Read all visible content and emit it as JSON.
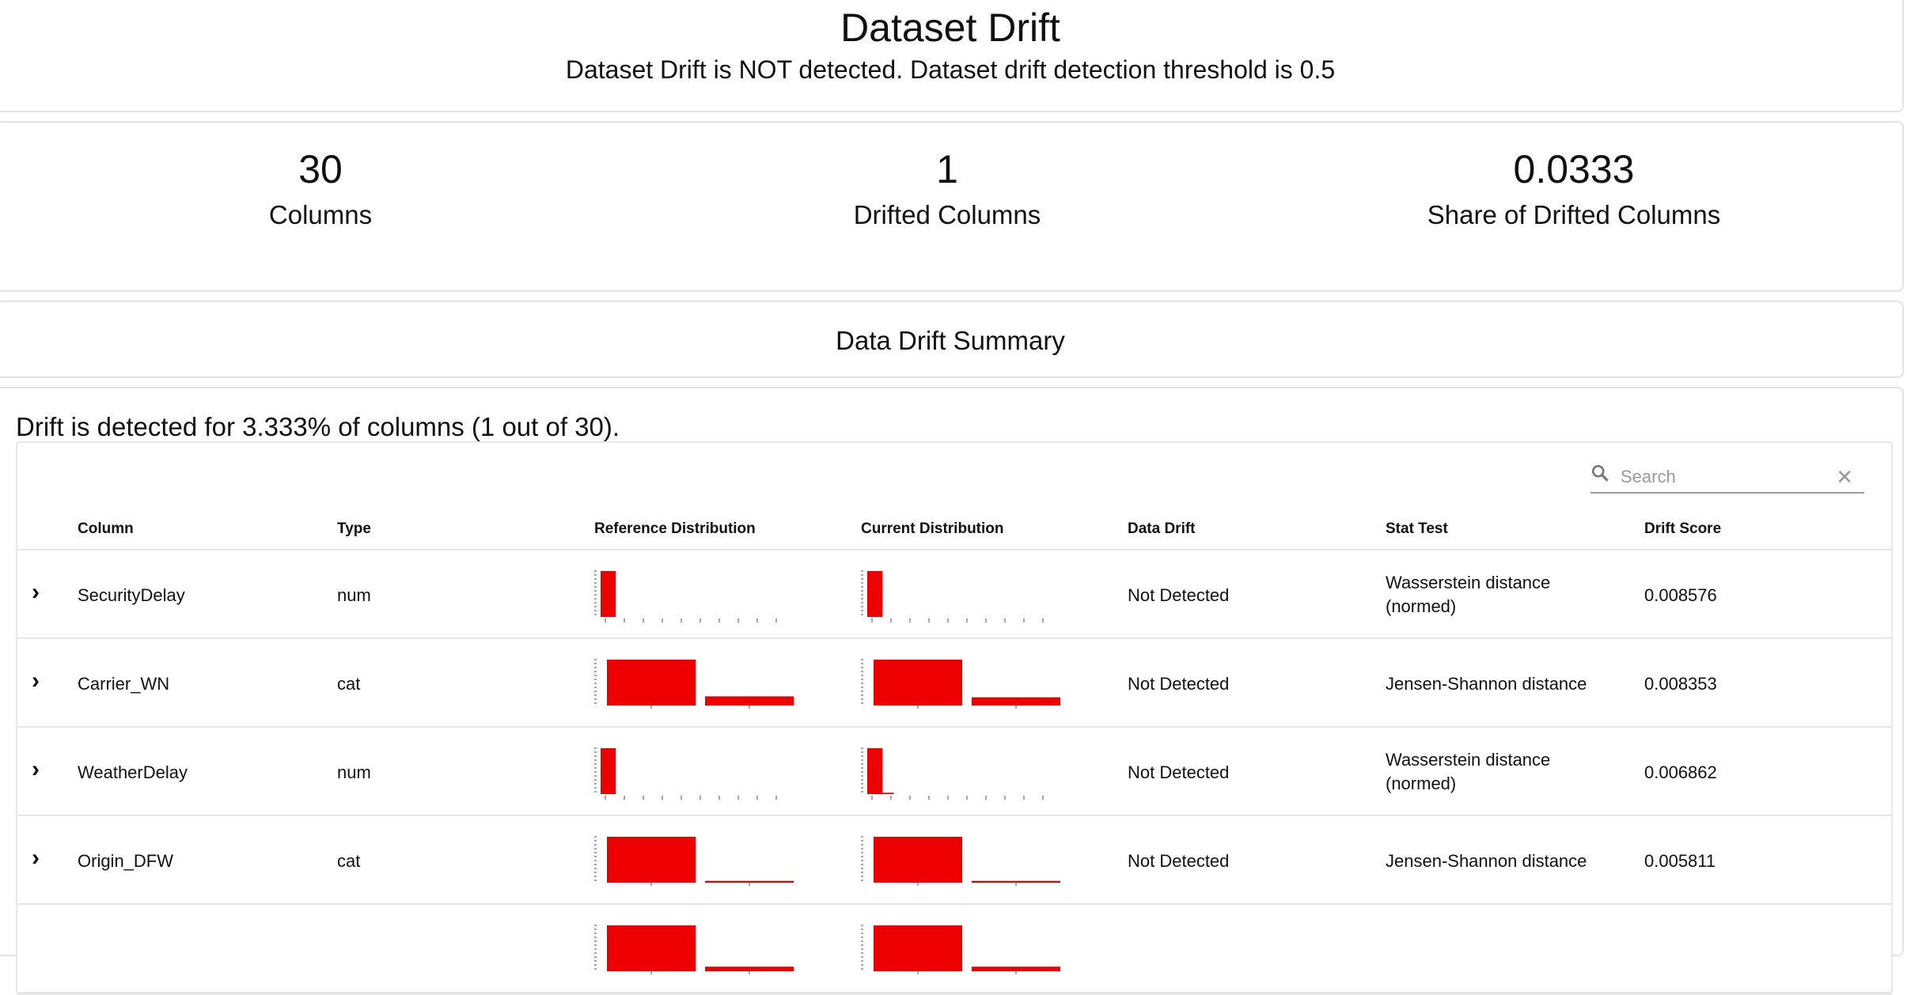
{
  "header": {
    "title": "Dataset Drift",
    "subtitle": "Dataset Drift is NOT detected. Dataset drift detection threshold is 0.5"
  },
  "metrics": [
    {
      "value": "30",
      "label": "Columns"
    },
    {
      "value": "1",
      "label": "Drifted Columns"
    },
    {
      "value": "0.0333",
      "label": "Share of Drifted Columns"
    }
  ],
  "summary_title": "Data Drift Summary",
  "drift_note": "Drift is detected for 3.333% of columns (1 out of 30).",
  "search": {
    "placeholder": "Search"
  },
  "colors": {
    "bar": "#ee0000",
    "axis": "#555555"
  },
  "table": {
    "headers": [
      "Column",
      "Type",
      "Reference Distribution",
      "Current Distribution",
      "Data Drift",
      "Stat Test",
      "Drift Score"
    ],
    "rows": [
      {
        "column": "SecurityDelay",
        "type": "num",
        "drift": "Not Detected",
        "stat_test_line1": "Wasserstein distance",
        "stat_test_line2": "(normed)",
        "score": "0.008576",
        "ref_hist": [
          1.0,
          0,
          0,
          0,
          0,
          0,
          0,
          0,
          0,
          0
        ],
        "cur_hist": [
          1.0,
          0,
          0,
          0,
          0,
          0,
          0,
          0,
          0,
          0
        ],
        "kind": "num"
      },
      {
        "column": "Carrier_WN",
        "type": "cat",
        "drift": "Not Detected",
        "stat_test_line1": "Jensen-Shannon distance",
        "stat_test_line2": "",
        "score": "0.008353",
        "ref_hist": [
          1.0,
          0.2
        ],
        "cur_hist": [
          1.0,
          0.18
        ],
        "kind": "cat"
      },
      {
        "column": "WeatherDelay",
        "type": "num",
        "drift": "Not Detected",
        "stat_test_line1": "Wasserstein distance",
        "stat_test_line2": "(normed)",
        "score": "0.006862",
        "ref_hist": [
          1.0,
          0,
          0,
          0,
          0,
          0,
          0,
          0,
          0,
          0
        ],
        "cur_hist": [
          1.0,
          0.03,
          0,
          0,
          0,
          0,
          0,
          0,
          0,
          0
        ],
        "kind": "num"
      },
      {
        "column": "Origin_DFW",
        "type": "cat",
        "drift": "Not Detected",
        "stat_test_line1": "Jensen-Shannon distance",
        "stat_test_line2": "",
        "score": "0.005811",
        "ref_hist": [
          1.0,
          0.04
        ],
        "cur_hist": [
          1.0,
          0.04
        ],
        "kind": "cat"
      },
      {
        "column": "",
        "type": "",
        "drift": "",
        "stat_test_line1": "",
        "stat_test_line2": "",
        "score": "",
        "ref_hist": [
          1.0,
          0.1
        ],
        "cur_hist": [
          1.0,
          0.1
        ],
        "kind": "cat"
      }
    ]
  }
}
